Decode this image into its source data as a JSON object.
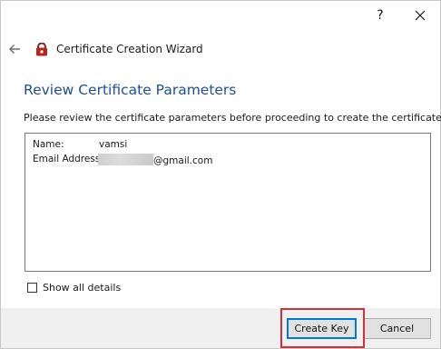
{
  "titlebar": {
    "help_label": "?",
    "close_icon": "close-icon"
  },
  "wizard": {
    "title": "Certificate Creation Wizard",
    "back_icon": "back-arrow-icon",
    "app_icon": "certificate-app-icon"
  },
  "page": {
    "heading": "Review Certificate Parameters",
    "instruction": "Please review the certificate parameters before proceeding to create the certificate."
  },
  "details": {
    "fields": [
      {
        "label": "Name:",
        "value": "vamsi"
      },
      {
        "label": "Email Address:",
        "value": "@gmail.com",
        "redacted_prefix": true
      }
    ]
  },
  "options": {
    "show_all_details_label": "Show all details",
    "show_all_details_checked": false
  },
  "footer": {
    "create_key_label": "Create Key",
    "cancel_label": "Cancel"
  },
  "colors": {
    "heading": "#1e4f93",
    "default_button_border": "#0078d7",
    "annotation_highlight": "#d1313d",
    "footer_background": "#f0f0f0"
  }
}
